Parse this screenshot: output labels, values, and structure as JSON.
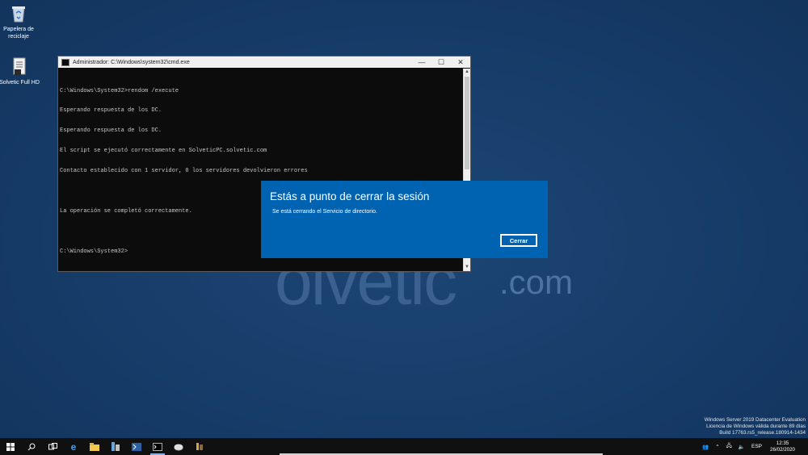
{
  "desktop": {
    "icons": [
      {
        "label": "Papelera de reciclaje",
        "icon": "recycle-bin-icon"
      },
      {
        "label": "Solvetic Full HD",
        "icon": "document-icon"
      }
    ],
    "watermark": {
      "brand": "olvetic",
      "domain": ".com"
    }
  },
  "cmd_window": {
    "title": "Administrador: C:\\Windows\\system32\\cmd.exe",
    "controls": {
      "minimize": "—",
      "maximize": "☐",
      "close": "✕"
    },
    "lines": [
      "C:\\Windows\\System32>rendom /execute",
      "Esperando respuesta de los DC.",
      "Esperando respuesta de los DC.",
      "El script se ejecutó correctamente en SolveticPC.solvetic.com",
      "Contacto establecido con 1 servidor, 0 los servidores devolvieron errores",
      "",
      "La operación se completó correctamente.",
      "",
      "C:\\Windows\\System32>"
    ]
  },
  "signout_dialog": {
    "title": "Estás a punto de cerrar la sesión",
    "message": "Se está cerrando el Servicio de directorio.",
    "close_button": "Cerrar"
  },
  "windows_watermark": {
    "line1": "Windows Server 2019 Datacenter Evaluation",
    "line2": "Licencia de Windows válida durante 89 días",
    "line3": "Build 17763.rs5_release.180914-1434"
  },
  "taskbar": {
    "items": [
      "start-icon",
      "search-icon",
      "task-view-icon",
      "internet-explorer-icon",
      "file-explorer-icon",
      "server-manager-icon",
      "powershell-icon",
      "cmd-icon",
      "disk-icon",
      "tools-icon"
    ],
    "tray": {
      "language": "ESP",
      "time": "12:35",
      "date": "26/02/2020"
    }
  },
  "colors": {
    "desktop": "#173b66",
    "dialog": "#0063b1",
    "taskbar": "#101010"
  }
}
